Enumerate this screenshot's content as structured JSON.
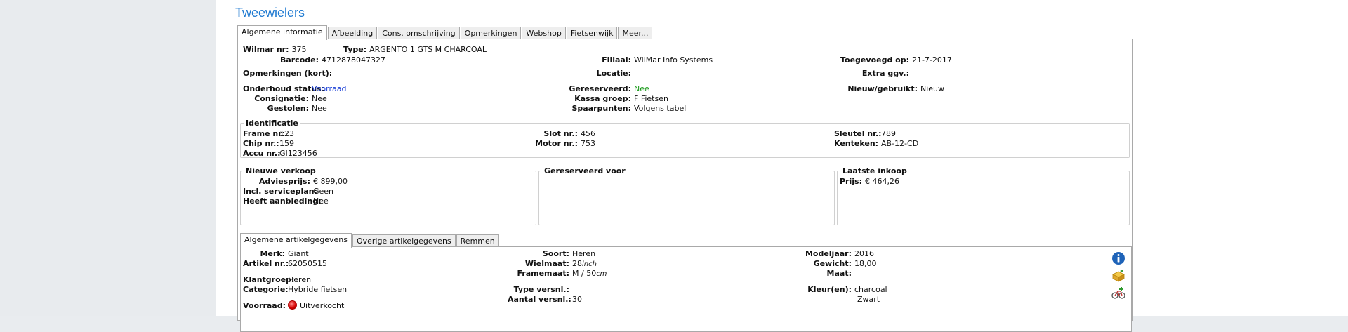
{
  "page": {
    "title": "Tweewielers"
  },
  "main_tabs": [
    "Algemene informatie",
    "Afbeelding",
    "Cons. omschrijving",
    "Opmerkingen",
    "Webshop",
    "Fietsenwijk",
    "Meer..."
  ],
  "header": {
    "wilmar_nr": {
      "label": "Wilmar nr:",
      "value": "375"
    },
    "type": {
      "label": "Type:",
      "value": "ARGENTO 1 GTS M CHARCOAL"
    },
    "barcode": {
      "label": "Barcode:",
      "value": "4712878047327"
    },
    "filiaal": {
      "label": "Filiaal:",
      "value": "WilMar Info Systems"
    },
    "toegevoegd": {
      "label": "Toegevoegd op:",
      "value": "21-7-2017"
    },
    "opmerkingen_kort": {
      "label": "Opmerkingen (kort):",
      "value": ""
    },
    "locatie": {
      "label": "Locatie:",
      "value": ""
    },
    "extra_ggv": {
      "label": "Extra ggv.:",
      "value": ""
    }
  },
  "status": {
    "onderhoud": {
      "label": "Onderhoud status:",
      "value": "Voorraad",
      "color": "#1a3fd6"
    },
    "consignatie": {
      "label": "Consignatie:",
      "value": "Nee"
    },
    "gestolen": {
      "label": "Gestolen:",
      "value": "Nee"
    },
    "gereserveerd": {
      "label": "Gereserveerd:",
      "value": "Nee",
      "color": "#1a9a1a"
    },
    "kassa_groep": {
      "label": "Kassa groep:",
      "value": "F Fietsen"
    },
    "spaarpunten": {
      "label": "Spaarpunten:",
      "value": "Volgens tabel"
    },
    "nieuw_gebruikt": {
      "label": "Nieuw/gebruikt:",
      "value": "Nieuw"
    }
  },
  "identificatie": {
    "title": "Identificatie",
    "frame_nr": {
      "label": "Frame nr:",
      "value": "123"
    },
    "chip_nr": {
      "label": "Chip nr.:",
      "value": "159"
    },
    "accu_nr": {
      "label": "Accu nr.:",
      "value": "GI123456"
    },
    "slot_nr": {
      "label": "Slot nr.:",
      "value": "456"
    },
    "motor_nr": {
      "label": "Motor nr.:",
      "value": "753"
    },
    "sleutel_nr": {
      "label": "Sleutel nr.:",
      "value": "789"
    },
    "kenteken": {
      "label": "Kenteken:",
      "value": "AB-12-CD"
    }
  },
  "nieuwe_verkoop": {
    "title": "Nieuwe verkoop",
    "adviesprijs": {
      "label": "Adviesprijs:",
      "value": "€ 899,00"
    },
    "serviceplan": {
      "label": "Incl. serviceplan:",
      "value": "Geen"
    },
    "aanbieding": {
      "label": "Heeft aanbieding:",
      "value": "Nee"
    }
  },
  "gereserveerd_voor": {
    "title": "Gereserveerd voor"
  },
  "laatste_inkoop": {
    "title": "Laatste inkoop",
    "prijs": {
      "label": "Prijs:",
      "value": "€ 464,26"
    }
  },
  "article_tabs": [
    "Algemene artikelgegevens",
    "Overige artikelgegevens",
    "Remmen"
  ],
  "artikel": {
    "merk": {
      "label": "Merk:",
      "value": "Giant"
    },
    "artikel_nr": {
      "label": "Artikel nr.:",
      "value": "62050515"
    },
    "klantgroep": {
      "label": "Klantgroep:",
      "value": "Heren"
    },
    "categorie": {
      "label": "Categorie:",
      "value": "Hybride fietsen"
    },
    "voorraad": {
      "label": "Voorraad:",
      "value": "Uitverkocht"
    },
    "soort": {
      "label": "Soort:",
      "value": "Heren"
    },
    "wielmaat": {
      "label": "Wielmaat:",
      "value": "28",
      "unit": "inch"
    },
    "framemaat": {
      "label": "Framemaat:",
      "value": "M / 50",
      "unit": "cm"
    },
    "type_versnl": {
      "label": "Type versnl.:",
      "value": ""
    },
    "aantal_versnl": {
      "label": "Aantal versnl.:",
      "value": "30"
    },
    "modeljaar": {
      "label": "Modeljaar:",
      "value": "2016"
    },
    "gewicht": {
      "label": "Gewicht:",
      "value": "18,00"
    },
    "maat": {
      "label": "Maat:",
      "value": ""
    },
    "kleuren": {
      "label": "Kleur(en):",
      "value": "charcoal",
      "value2": "Zwart"
    }
  },
  "icons": {
    "info": "info-icon",
    "box": "box-icon",
    "bike": "bike-add-icon"
  }
}
